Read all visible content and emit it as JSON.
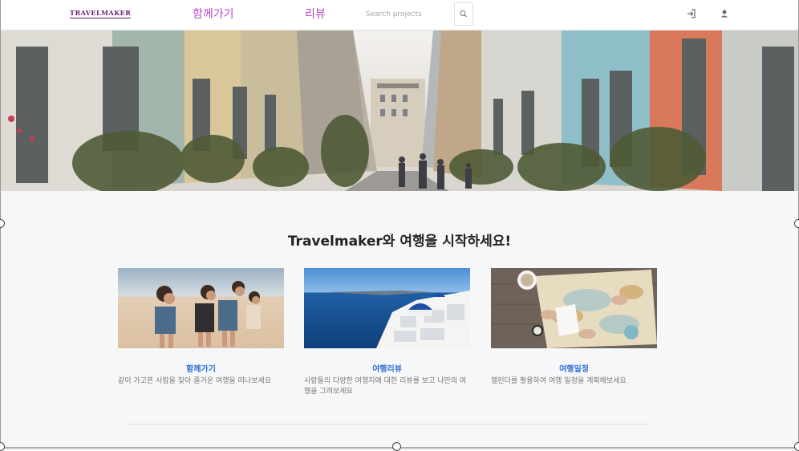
{
  "navbar": {
    "brand": "TRAVELMAKER",
    "links": [
      "함께가기",
      "리뷰"
    ],
    "search_placeholder": "Search projects",
    "icons": [
      "search-icon",
      "login-icon",
      "user-icon"
    ]
  },
  "main": {
    "heading": "Travelmaker와 여행을 시작하세요!",
    "cards": [
      {
        "title": "함께가기",
        "description": "같이 가고픈 사람을 찾아 즐거운 여행을 떠나보세요"
      },
      {
        "title": "여행리뷰",
        "description": "사람들의 다양한 여행지에 대한 리뷰를 보고 나만의 여행을 그려보세요"
      },
      {
        "title": "여행일정",
        "description": "캘린더를 활용하여 여행 일정을 계획해보세요"
      }
    ]
  },
  "colors": {
    "brand": "#6a1b6f",
    "nav_link": "#b545c9",
    "card_title": "#2f6fd6",
    "page_bg": "#f6f7f9"
  }
}
